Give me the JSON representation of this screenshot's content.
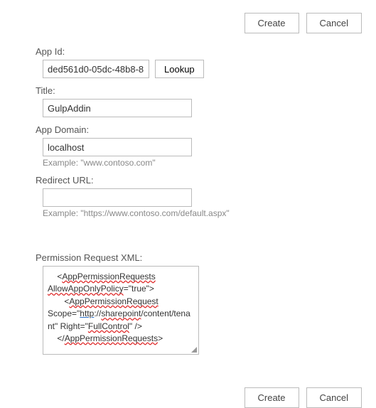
{
  "buttons": {
    "create": "Create",
    "cancel": "Cancel",
    "lookup": "Lookup"
  },
  "fields": {
    "appId": {
      "label": "App Id:",
      "value": "ded561d0-05dc-48b8-8"
    },
    "title": {
      "label": "Title:",
      "value": "GulpAddin"
    },
    "appDomain": {
      "label": "App Domain:",
      "value": "localhost",
      "example": "Example: \"www.contoso.com\""
    },
    "redirectUrl": {
      "label": "Redirect URL:",
      "value": "",
      "example": "Example: \"https://www.contoso.com/default.aspx\""
    },
    "permissionXml": {
      "label": "Permission Request XML:",
      "open_tag_name": "AppPermissionRequests",
      "allow_app_only_attr": "AllowAppOnlyPolicy",
      "allow_app_only_value": "=\"true\">",
      "request_tag_name": "AppPermissionRequest",
      "scope_prefix": "Scope=\"",
      "scope_http": "http",
      "scope_sep1": "://",
      "scope_sharepoint": "sharepoint",
      "scope_rest": "/content/tenant\" Right=\"",
      "full_control": "FullControl",
      "close_attr": "\" />",
      "close_tag_name": "AppPermissionRequests"
    }
  }
}
